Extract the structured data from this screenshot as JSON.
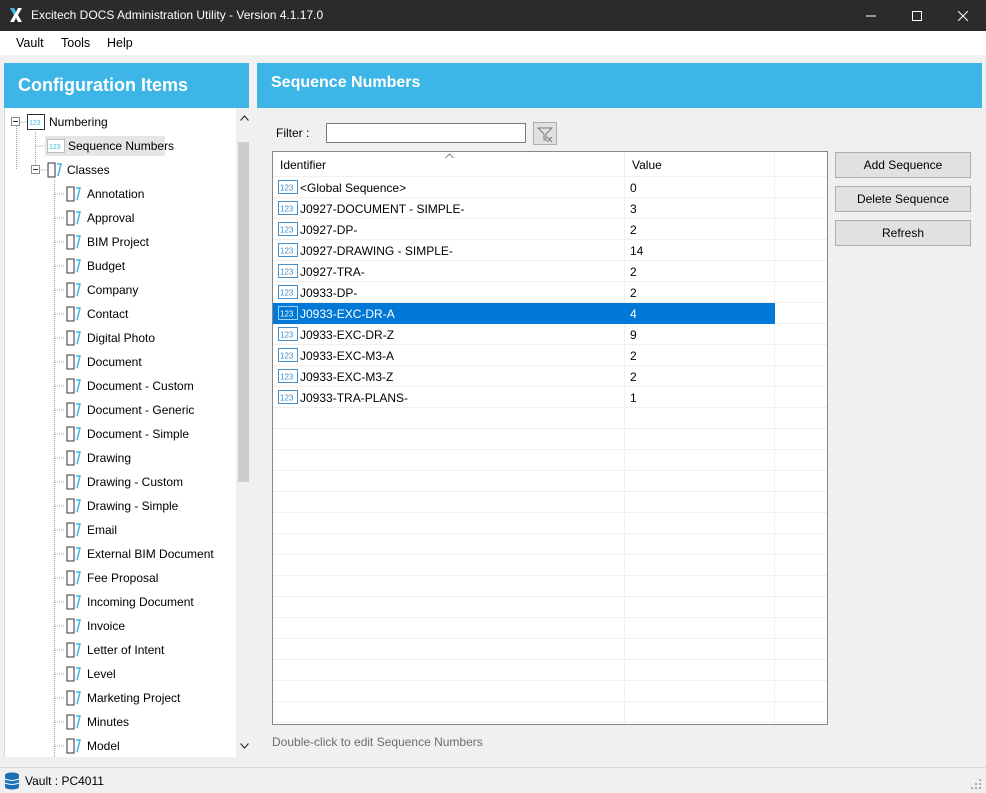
{
  "window": {
    "title": "Excitech DOCS Administration Utility - Version 4.1.17.0"
  },
  "menu": {
    "items": [
      {
        "label": "Vault"
      },
      {
        "label": "Tools"
      },
      {
        "label": "Help"
      }
    ]
  },
  "left_panel": {
    "title": "Configuration Items",
    "tree": {
      "root": "Numbering",
      "sequence_numbers": "Sequence Numbers",
      "classes": "Classes",
      "class_items": [
        "Annotation",
        "Approval",
        "BIM Project",
        "Budget",
        "Company",
        "Contact",
        "Digital Photo",
        "Document",
        "Document - Custom",
        "Document - Generic",
        "Document - Simple",
        "Drawing",
        "Drawing - Custom",
        "Drawing - Simple",
        "Email",
        "External BIM Document",
        "Fee Proposal",
        "Incoming Document",
        "Invoice",
        "Letter of Intent",
        "Level",
        "Marketing Project",
        "Minutes",
        "Model"
      ]
    }
  },
  "right_panel": {
    "title": "Sequence Numbers",
    "filter": {
      "label": "Filter :",
      "value": ""
    },
    "grid": {
      "columns": [
        "Identifier",
        "Value"
      ],
      "rows": [
        {
          "identifier": "<Global Sequence>",
          "value": "0"
        },
        {
          "identifier": "J0927-DOCUMENT - SIMPLE-",
          "value": "3"
        },
        {
          "identifier": "J0927-DP-",
          "value": "2"
        },
        {
          "identifier": "J0927-DRAWING - SIMPLE-",
          "value": "14"
        },
        {
          "identifier": "J0927-TRA-",
          "value": "2"
        },
        {
          "identifier": "J0933-DP-",
          "value": "2"
        },
        {
          "identifier": "J0933-EXC-DR-A",
          "value": "4",
          "selected": true
        },
        {
          "identifier": "J0933-EXC-DR-Z",
          "value": "9"
        },
        {
          "identifier": "J0933-EXC-M3-A",
          "value": "2"
        },
        {
          "identifier": "J0933-EXC-M3-Z",
          "value": "2"
        },
        {
          "identifier": "J0933-TRA-PLANS-",
          "value": "1"
        }
      ],
      "row_icon_text": "123"
    },
    "buttons": {
      "add": "Add Sequence",
      "delete": "Delete Sequence",
      "refresh": "Refresh"
    },
    "hint": "Double-click to edit Sequence Numbers"
  },
  "status": {
    "vault": "Vault : PC4011"
  },
  "colors": {
    "accent": "#3db5e6",
    "selection": "#0078d7",
    "titlebar": "#2b2b2b"
  }
}
